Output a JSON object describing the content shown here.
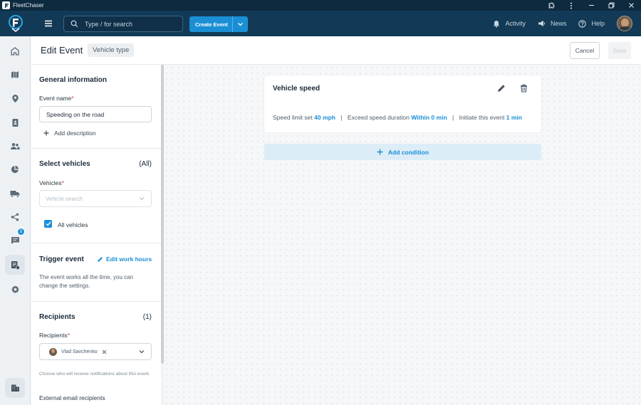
{
  "window": {
    "title": "FleetChaser"
  },
  "topbar": {
    "search_placeholder": "Type / for search",
    "create_event_label": "Create Event",
    "links": {
      "activity": "Activity",
      "news": "News",
      "help": "Help"
    }
  },
  "nav": {
    "items": [
      "home-icon",
      "map-icon",
      "location-pin-icon",
      "contacts-book-icon",
      "people-icon",
      "pie-chart-icon",
      "truck-icon",
      "share-icon",
      "chat-icon",
      "events-icon",
      "gear-icon",
      "company-icon"
    ],
    "chat_badge": "5",
    "active": "events-icon"
  },
  "header": {
    "title": "Edit Event",
    "tag": "Vehicle type",
    "cancel_label": "Cancel",
    "save_label": "Save"
  },
  "form": {
    "general": {
      "title": "General information",
      "event_name_label": "Event name",
      "event_name_value": "Speeding on the road",
      "add_description": "Add description"
    },
    "vehicles": {
      "title": "Select vehicles",
      "count": "(All)",
      "label": "Vehicles",
      "placeholder": "Vehicle search",
      "all_label": "All vehicles",
      "all_checked": true
    },
    "trigger": {
      "title": "Trigger event",
      "edit_label": "Edit work hours",
      "description": "The event works all the time, you can change the settings."
    },
    "recipients": {
      "title": "Recipients",
      "count": "(1)",
      "label": "Recipients",
      "chip": "Vlad Savchenko",
      "help": "Choose who will receive notifications about this event.",
      "external_label": "External email recipients"
    }
  },
  "condition": {
    "title": "Vehicle speed",
    "speed_limit_label": "Speed limit set",
    "speed_limit_value": "40 mph",
    "exceed_label": "Exceed speed duration",
    "exceed_value": "Within 0 min",
    "initiate_label": "Initiate this event",
    "initiate_value": "1 min",
    "separator": "|",
    "add_condition_label": "Add condition"
  },
  "colors": {
    "accent": "#1a8fd6",
    "topbar": "#123a56",
    "titlebar": "#0e2a3e"
  }
}
